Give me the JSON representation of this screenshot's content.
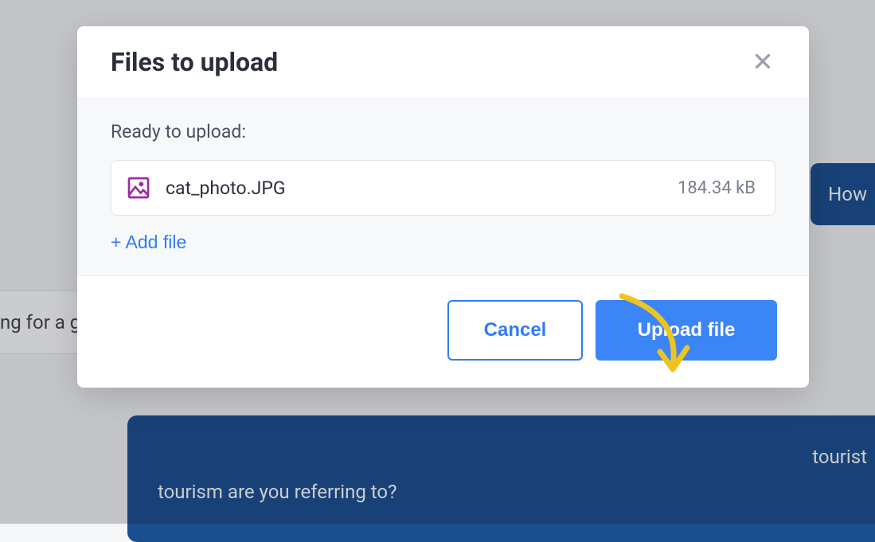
{
  "background": {
    "right1": "How",
    "left": "ng for a g",
    "right2_line1": "tourist",
    "right2_line2": "tourism are you referring to?"
  },
  "modal": {
    "title": "Files to upload",
    "ready_label": "Ready to upload:",
    "file": {
      "name": "cat_photo.JPG",
      "size": "184.34 kB"
    },
    "add_file_label": "+ Add file",
    "cancel_label": "Cancel",
    "upload_label": "Upload file"
  }
}
